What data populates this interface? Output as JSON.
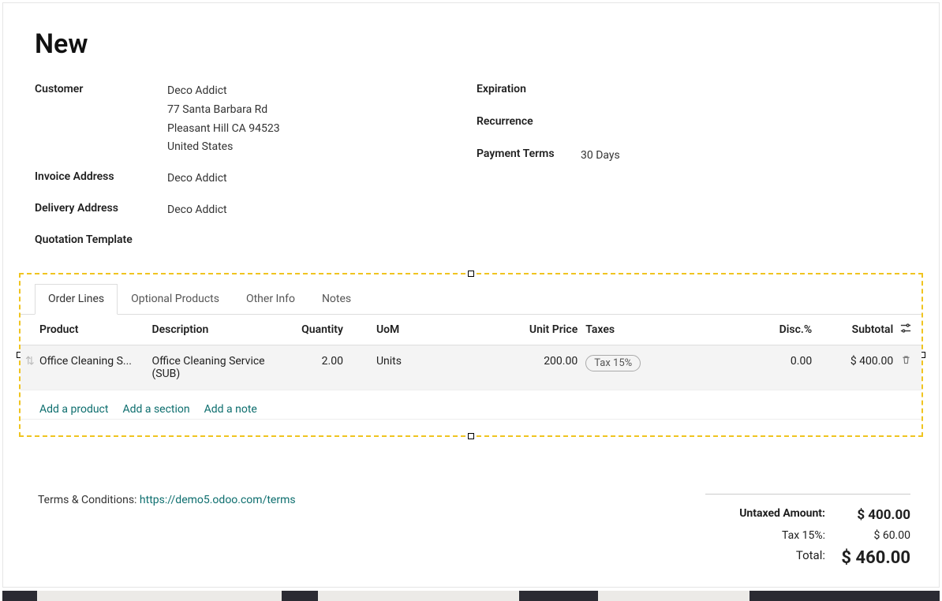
{
  "title": "New",
  "left_fields": {
    "customer_label": "Customer",
    "customer_name": "Deco Addict",
    "customer_addr1": "77 Santa Barbara Rd",
    "customer_addr2": "Pleasant Hill CA 94523",
    "customer_addr3": "United States",
    "invoice_label": "Invoice Address",
    "invoice_value": "Deco Addict",
    "delivery_label": "Delivery Address",
    "delivery_value": "Deco Addict",
    "template_label": "Quotation Template"
  },
  "right_fields": {
    "expiration_label": "Expiration",
    "recurrence_label": "Recurrence",
    "payment_label": "Payment Terms",
    "payment_value": "30 Days"
  },
  "tabs": {
    "order_lines": "Order Lines",
    "optional": "Optional Products",
    "other": "Other Info",
    "notes": "Notes"
  },
  "headers": {
    "product": "Product",
    "description": "Description",
    "quantity": "Quantity",
    "uom": "UoM",
    "unit_price": "Unit Price",
    "taxes": "Taxes",
    "disc": "Disc.%",
    "subtotal": "Subtotal"
  },
  "lines": [
    {
      "product": "Office Cleaning S...",
      "description": "Office Cleaning Service (SUB)",
      "quantity": "2.00",
      "uom": "Units",
      "unit_price": "200.00",
      "tax": "Tax 15%",
      "disc": "0.00",
      "subtotal": "$ 400.00"
    }
  ],
  "add_actions": {
    "product": "Add a product",
    "section": "Add a section",
    "note": "Add a note"
  },
  "terms": {
    "label": "Terms & Conditions: ",
    "link": "https://demo5.odoo.com/terms"
  },
  "totals": {
    "untaxed_label": "Untaxed Amount:",
    "untaxed_value": "$ 400.00",
    "tax_label": "Tax 15%:",
    "tax_value": "$ 60.00",
    "total_label": "Total:",
    "total_value": "$ 460.00"
  }
}
